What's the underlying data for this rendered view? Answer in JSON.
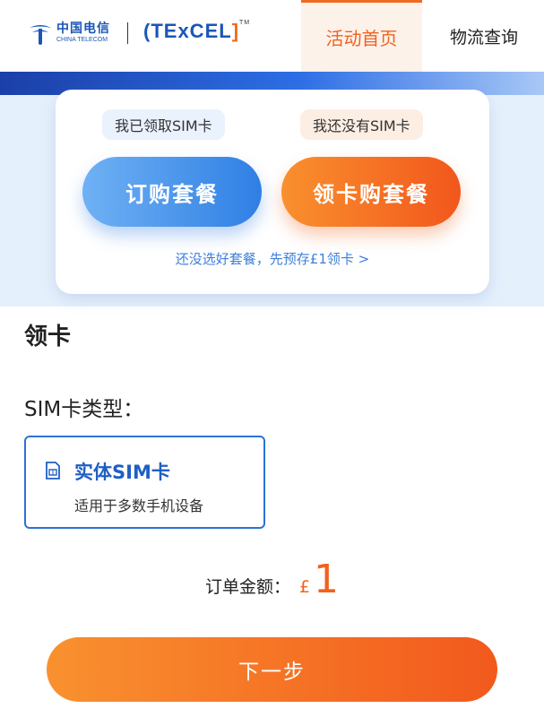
{
  "header": {
    "brand_cn": "中国电信",
    "brand_en": "CHINA TELECOM",
    "partner_logo_text": "TExCEL",
    "partner_logo_mark": "TM",
    "nav_home": "活动首页",
    "nav_logistics": "物流查询"
  },
  "card": {
    "tag_have_sim": "我已领取SIM卡",
    "tag_no_sim": "我还没有SIM卡",
    "order_plan_button": "订购套餐",
    "get_card_button": "领卡购套餐",
    "prestore_link": "还没选好套餐，先预存£1领卡 >"
  },
  "section": {
    "title": "领卡",
    "sim_type_label": "SIM卡类型：",
    "sim_option": {
      "name": "实体SIM卡",
      "desc": "适用于多数手机设备"
    }
  },
  "order": {
    "total_label": "订单金额：",
    "currency": "£",
    "amount": "1"
  },
  "next_button": "下一步",
  "colors": {
    "accent_orange": "#f0621e",
    "accent_blue": "#2a73d6",
    "bg_light_blue": "#e5f0fd"
  }
}
